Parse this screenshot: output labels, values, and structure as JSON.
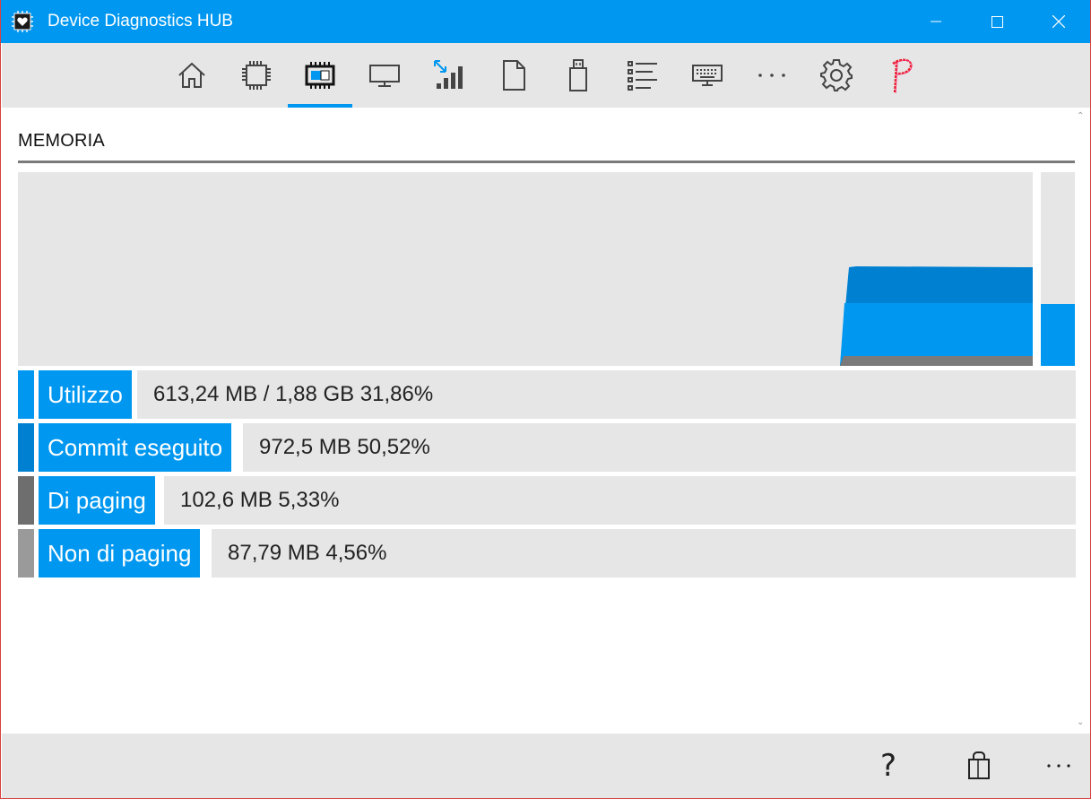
{
  "window": {
    "title": "Device Diagnostics HUB",
    "accent_color": "#0097f0",
    "close_border_color": "#d8403f"
  },
  "nav": {
    "items": [
      {
        "icon": "home-icon",
        "active": false
      },
      {
        "icon": "cpu-icon",
        "active": false
      },
      {
        "icon": "memory-icon",
        "active": true
      },
      {
        "icon": "display-icon",
        "active": false
      },
      {
        "icon": "network-signal-icon",
        "active": false
      },
      {
        "icon": "file-icon",
        "active": false
      },
      {
        "icon": "usb-drive-icon",
        "active": false
      },
      {
        "icon": "list-icon",
        "active": false
      },
      {
        "icon": "keyboard-icon",
        "active": false
      },
      {
        "icon": "more-icon",
        "active": false
      },
      {
        "icon": "settings-gear-icon",
        "active": false
      },
      {
        "icon": "p-logo-icon",
        "active": false
      }
    ]
  },
  "section": {
    "title": "MEMORIA"
  },
  "memory_graph": {
    "usage_level_percent": 31.86,
    "series_colors": {
      "commit": "#0080d0",
      "used": "#0097f0",
      "paged": "#7a7a7a"
    }
  },
  "stats": [
    {
      "label": "Utilizzo",
      "value": "613,24 MB / 1,88 GB 31,86%",
      "swatch_color": "#0097f0"
    },
    {
      "label": "Commit eseguito",
      "value": "972,5 MB 50,52%",
      "swatch_color": "#0080d0"
    },
    {
      "label": "Di paging",
      "value": "102,6 MB 5,33%",
      "swatch_color": "#6e6e6e"
    },
    {
      "label": "Non di paging",
      "value": "87,79 MB 4,56%",
      "swatch_color": "#9a9a9a"
    }
  ],
  "appbar": {
    "help_label": "?",
    "icons": [
      "help-icon",
      "store-bag-icon",
      "more-icon"
    ]
  }
}
